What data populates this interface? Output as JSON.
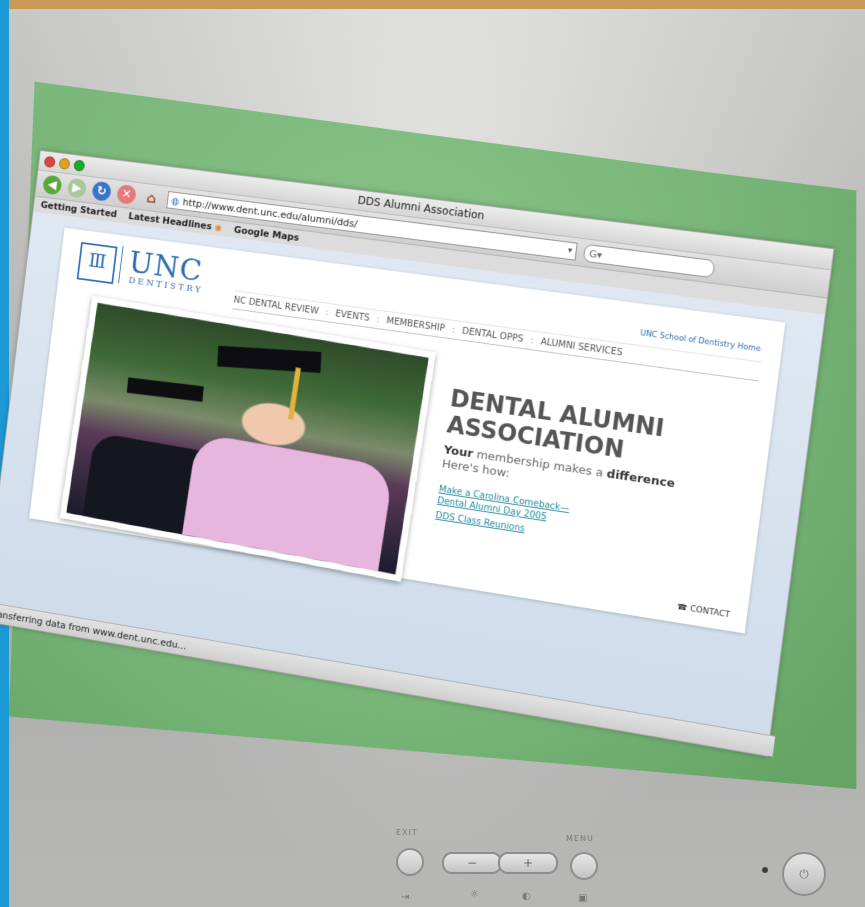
{
  "window": {
    "title": "DDS Alumni Association",
    "url": "http://www.dent.unc.edu/alumni/dds/",
    "search_placeholder": "G▾"
  },
  "bookmarks": [
    "Getting Started",
    "Latest Headlines",
    "Google Maps"
  ],
  "site": {
    "logo_text": "UNC",
    "logo_subtext": "DENTISTRY",
    "home_link": "UNC School of Dentistry Home",
    "nav": [
      "NC DENTAL REVIEW",
      "EVENTS",
      "MEMBERSHIP",
      "DENTAL OPPS",
      "ALUMNI SERVICES"
    ],
    "nav_separator": ":",
    "promo_title_line1": "DENTAL ALUMNI",
    "promo_title_line2": "ASSOCIATION",
    "promo_sub_bold": "Your",
    "promo_sub_rest": " membership makes a ",
    "promo_sub_bold2": "difference",
    "promo_sub_line2": "Here's how:",
    "links": [
      "Make a Carolina Comeback—",
      "Dental Alumni Day 2005",
      "DDS Class Reunions"
    ],
    "contact": "CONTACT"
  },
  "status": "Transferring data from www.dent.unc.edu...",
  "monitor": {
    "exit_label": "EXIT",
    "menu_label": "MENU",
    "minus": "−",
    "plus": "+"
  },
  "colors": {
    "screen_green": "#8ccf8c",
    "unc_blue": "#2f6db5",
    "link_teal": "#1f8a9a",
    "frame_gold": "#c89a55",
    "frame_blue": "#1b9ad6"
  }
}
